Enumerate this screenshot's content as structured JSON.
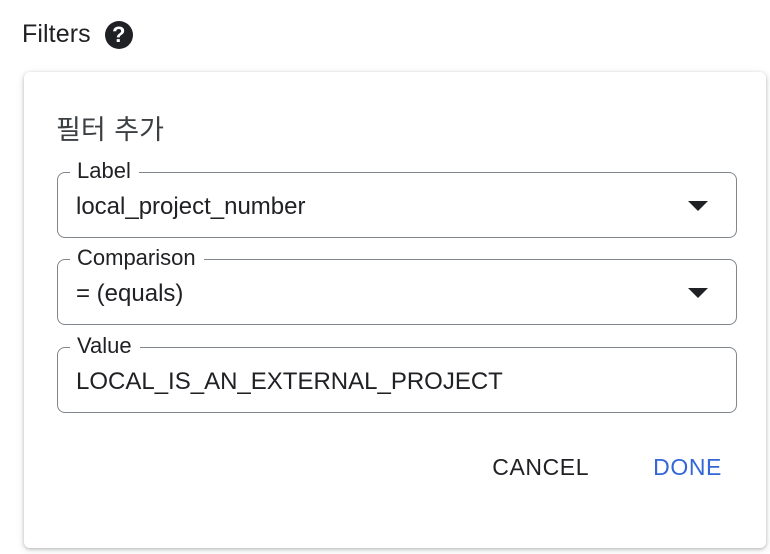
{
  "header": {
    "title": "Filters",
    "help_icon": "?"
  },
  "dialog": {
    "title": "필터 추가",
    "fields": {
      "label": {
        "label": "Label",
        "value": "local_project_number"
      },
      "comparison": {
        "label": "Comparison",
        "value": "= (equals)"
      },
      "value": {
        "label": "Value",
        "value": "LOCAL_IS_AN_EXTERNAL_PROJECT"
      }
    },
    "actions": {
      "cancel": "CANCEL",
      "done": "DONE"
    }
  },
  "colors": {
    "accent": "#3367d6",
    "text": "#202124",
    "border": "#80868b"
  },
  "icons": {
    "help": "help-circle-icon",
    "dropdown": "arrow-drop-down-icon"
  }
}
